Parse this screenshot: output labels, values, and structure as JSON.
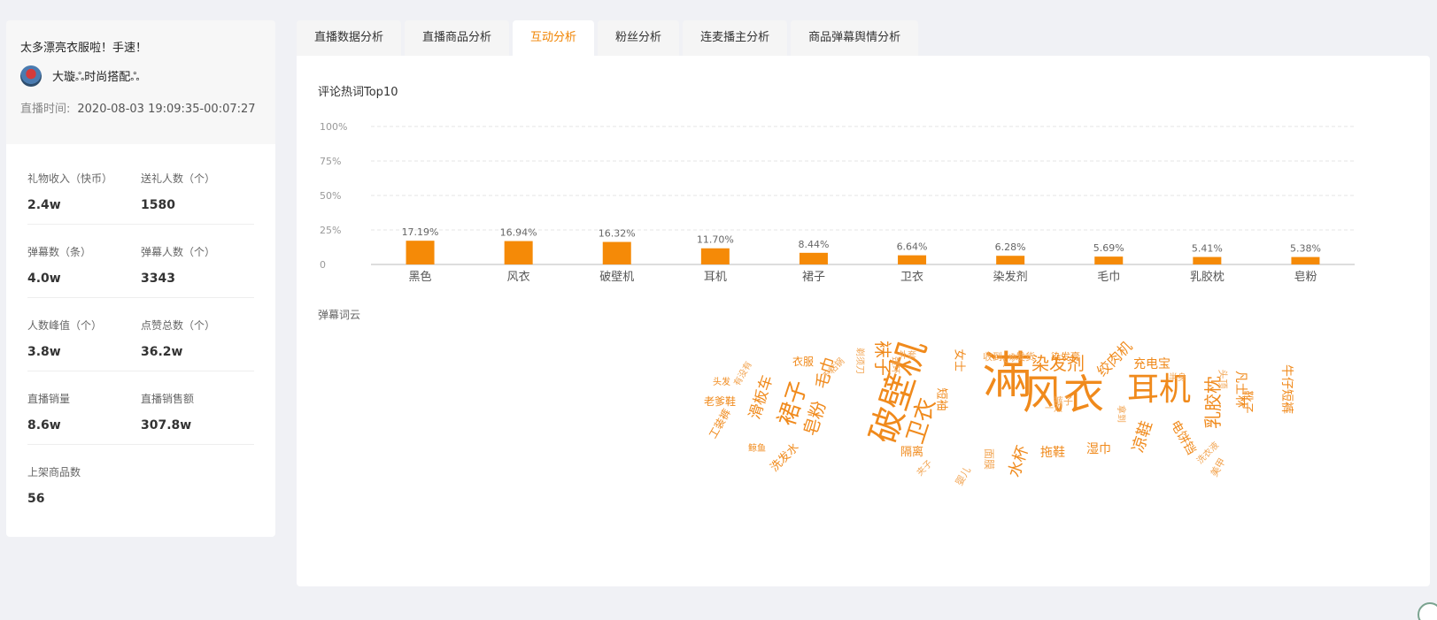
{
  "live": {
    "title": "太多漂亮衣服啦！手速！",
    "anchor_name": "大璇ஃ时尚搭配ஃ",
    "time_label": "直播时间:",
    "time_value": "2020-08-03 19:09:35-00:07:27"
  },
  "stats": [
    [
      {
        "label": "礼物收入（快币）",
        "value": "2.4w"
      },
      {
        "label": "送礼人数（个）",
        "value": "1580"
      }
    ],
    [
      {
        "label": "弹幕数（条）",
        "value": "4.0w"
      },
      {
        "label": "弹幕人数（个）",
        "value": "3343"
      }
    ],
    [
      {
        "label": "人数峰值（个）",
        "value": "3.8w"
      },
      {
        "label": "点赞总数（个）",
        "value": "36.2w"
      }
    ],
    [
      {
        "label": "直播销量",
        "value": "8.6w"
      },
      {
        "label": "直播销售额",
        "value": "307.8w"
      }
    ],
    [
      {
        "label": "上架商品数",
        "value": "56"
      }
    ]
  ],
  "tabs": [
    "直播数据分析",
    "直播商品分析",
    "互动分析",
    "粉丝分析",
    "连麦播主分析",
    "商品弹幕舆情分析"
  ],
  "active_tab": "互动分析",
  "sections": {
    "top_title": "评论热词Top10",
    "cloud_title": "弹幕词云"
  },
  "colors": {
    "accent": "#f08300",
    "bar": "#f58a07"
  },
  "chart_data": {
    "type": "bar",
    "categories": [
      "黑色",
      "风衣",
      "破壁机",
      "耳机",
      "裙子",
      "卫衣",
      "染发剂",
      "毛巾",
      "乳胶枕",
      "皂粉"
    ],
    "values": [
      17.19,
      16.94,
      16.32,
      11.7,
      8.44,
      6.64,
      6.28,
      5.69,
      5.41,
      5.38
    ],
    "value_labels": [
      "17.19%",
      "16.94%",
      "16.32%",
      "11.70%",
      "8.44%",
      "6.64%",
      "6.28%",
      "5.69%",
      "5.41%",
      "5.38%"
    ],
    "y_ticks": [
      "0",
      "25%",
      "50%",
      "75%",
      "100%"
    ],
    "ylim": [
      0,
      100
    ],
    "grid": true
  },
  "word_cloud": [
    "滿",
    "风衣",
    "破壁机",
    "耳机",
    "裙子",
    "卫衣",
    "染发剂",
    "皂粉",
    "毛巾",
    "乳胶枕",
    "袜子",
    "凉鞋",
    "电饼铛",
    "滑板车",
    "水杯",
    "拖鞋",
    "绞肉机",
    "充电宝",
    "隔离",
    "湿巾",
    "洗发水",
    "工装裤",
    "老爹鞋",
    "牛仔短裤",
    "凡士林",
    "靴子",
    "短袖",
    "衣服",
    "女士",
    "染发膏",
    "头发",
    "鲸鱼",
    "收到",
    "发货",
    "有没有",
    "外套",
    "裤子",
    "不粘锅",
    "剃须刀",
    "面膜",
    "婴儿",
    "拿到",
    "夹子",
    "颈环",
    "半身",
    "头顶",
    "美甲",
    "一双",
    "人参",
    "洗衣液"
  ]
}
